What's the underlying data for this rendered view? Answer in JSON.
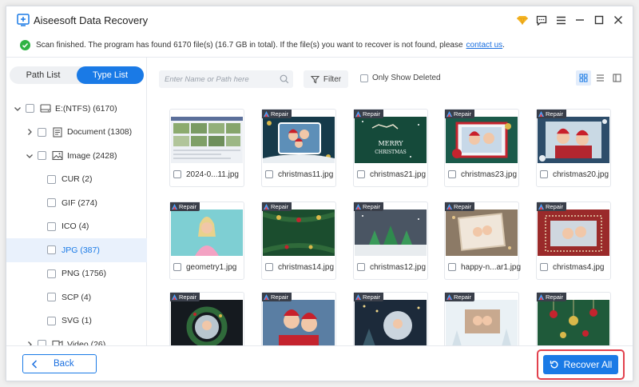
{
  "app": {
    "title": "Aiseesoft Data Recovery"
  },
  "notice": {
    "text": "Scan finished. The program has found 6170 file(s) (16.7 GB in total). If the file(s) you want to recover is not found, please",
    "link": "contact us",
    "suffix": "."
  },
  "sidebar": {
    "tabs": [
      {
        "label": "Path List",
        "active": false
      },
      {
        "label": "Type List",
        "active": true
      }
    ],
    "tree": [
      {
        "label": "E:(NTFS) (6170)",
        "level": 0,
        "expand": "down",
        "icon": "drive-icon"
      },
      {
        "label": "Document (1308)",
        "level": 1,
        "expand": "right",
        "icon": "document-icon"
      },
      {
        "label": "Image (2428)",
        "level": 1,
        "expand": "down",
        "icon": "image-icon"
      },
      {
        "label": "CUR (2)",
        "level": 2,
        "expand": "",
        "icon": ""
      },
      {
        "label": "GIF (274)",
        "level": 2,
        "expand": "",
        "icon": ""
      },
      {
        "label": "ICO (4)",
        "level": 2,
        "expand": "",
        "icon": ""
      },
      {
        "label": "JPG (387)",
        "level": 2,
        "expand": "",
        "icon": "",
        "selected": true
      },
      {
        "label": "PNG (1756)",
        "level": 2,
        "expand": "",
        "icon": ""
      },
      {
        "label": "SCP (4)",
        "level": 2,
        "expand": "",
        "icon": ""
      },
      {
        "label": "SVG (1)",
        "level": 2,
        "expand": "",
        "icon": ""
      },
      {
        "label": "Video (26)",
        "level": 1,
        "expand": "right",
        "icon": "video-icon"
      }
    ]
  },
  "toolbar": {
    "search_placeholder": "Enter Name or Path here",
    "filter_label": "Filter",
    "only_deleted_label": "Only Show Deleted"
  },
  "files": [
    {
      "name": "2024-0...11.jpg",
      "badge": "",
      "theme": "screenshot"
    },
    {
      "name": "christmas11.jpg",
      "badge": "Repair",
      "theme": "xmas-family"
    },
    {
      "name": "christmas21.jpg",
      "badge": "Repair",
      "theme": "xmas-sleigh"
    },
    {
      "name": "christmas23.jpg",
      "badge": "Repair",
      "theme": "xmas-frame-red"
    },
    {
      "name": "christmas20.jpg",
      "badge": "Repair",
      "theme": "xmas-kids"
    },
    {
      "name": "geometry1.jpg",
      "badge": "Repair",
      "theme": "geometry"
    },
    {
      "name": "christmas14.jpg",
      "badge": "Repair",
      "theme": "xmas-garland"
    },
    {
      "name": "christmas12.jpg",
      "badge": "Repair",
      "theme": "xmas-trees"
    },
    {
      "name": "happy-n...ar1.jpg",
      "badge": "Repair",
      "theme": "new-year"
    },
    {
      "name": "christmas4.jpg",
      "badge": "Repair",
      "theme": "xmas-red-frame"
    },
    {
      "name": "",
      "badge": "Repair",
      "theme": "xmas-wreath"
    },
    {
      "name": "",
      "badge": "Repair",
      "theme": "xmas-couple"
    },
    {
      "name": "",
      "badge": "Repair",
      "theme": "xmas-night"
    },
    {
      "name": "",
      "badge": "Repair",
      "theme": "xmas-snow"
    },
    {
      "name": "",
      "badge": "Repair",
      "theme": "xmas-ornaments"
    }
  ],
  "footer": {
    "back_label": "Back",
    "recover_label": "Recover All"
  },
  "colors": {
    "accent": "#1a7ae6",
    "highlight": "#e2414d",
    "success": "#2fb344"
  }
}
